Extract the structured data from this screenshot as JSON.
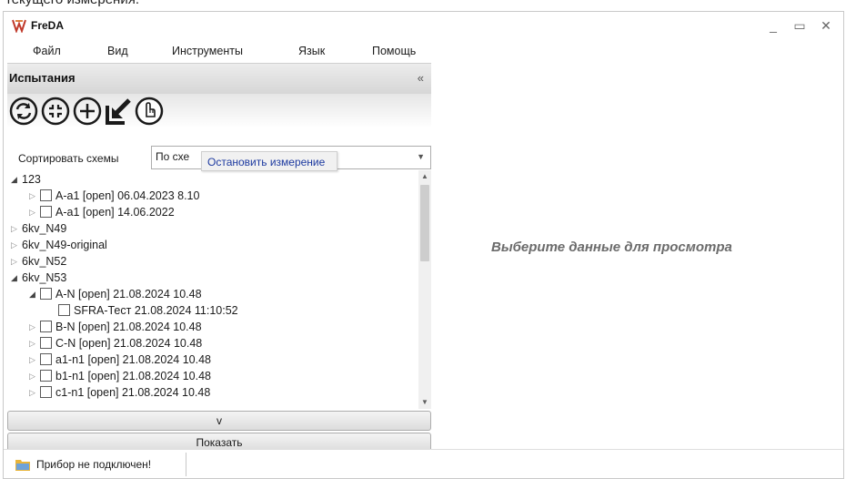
{
  "top_strip": {
    "text": "текущего измерения."
  },
  "window": {
    "title": "FreDA",
    "controls": {
      "minimize": "_",
      "maximize": "▭",
      "close": "✕"
    }
  },
  "menu": [
    "Файл",
    "Вид",
    "Инструменты",
    "Язык",
    "Помощь"
  ],
  "panel": {
    "title": "Испытания",
    "collapse_glyph": "«",
    "toolbar_icons": [
      "refresh-icon",
      "fit-icon",
      "add-icon",
      "import-icon",
      "stop-measurement-icon"
    ],
    "sort": {
      "label": "Сортировать схемы",
      "value": "По схе"
    },
    "tooltip": "Остановить измерение",
    "tree": [
      {
        "text": "123",
        "level": 0,
        "expand": "open",
        "checkbox": false
      },
      {
        "text": "A-a1 [open] 06.04.2023 8.10",
        "level": 1,
        "expand": "closed",
        "checkbox": true
      },
      {
        "text": "A-a1 [open] 14.06.2022",
        "level": 1,
        "expand": "closed",
        "checkbox": true
      },
      {
        "text": "6kv_N49",
        "level": 0,
        "expand": "closed",
        "checkbox": false
      },
      {
        "text": "6kv_N49-original",
        "level": 0,
        "expand": "closed",
        "checkbox": false
      },
      {
        "text": "6kv_N52",
        "level": 0,
        "expand": "closed",
        "checkbox": false
      },
      {
        "text": "6kv_N53",
        "level": 0,
        "expand": "open",
        "checkbox": false
      },
      {
        "text": "A-N [open] 21.08.2024 10.48",
        "level": 1,
        "expand": "open",
        "checkbox": true
      },
      {
        "text": "SFRA-Тест 21.08.2024 11:10:52",
        "level": 2,
        "expand": "none",
        "checkbox": true
      },
      {
        "text": "B-N [open] 21.08.2024 10.48",
        "level": 1,
        "expand": "closed",
        "checkbox": true
      },
      {
        "text": "C-N [open] 21.08.2024 10.48",
        "level": 1,
        "expand": "closed",
        "checkbox": true
      },
      {
        "text": "a1-n1 [open] 21.08.2024 10.48",
        "level": 1,
        "expand": "closed",
        "checkbox": true
      },
      {
        "text": "b1-n1 [open] 21.08.2024 10.48",
        "level": 1,
        "expand": "closed",
        "checkbox": true
      },
      {
        "text": "c1-n1 [open] 21.08.2024 10.48",
        "level": 1,
        "expand": "closed",
        "checkbox": true
      }
    ],
    "expand_button": "v",
    "show_button": "Показать"
  },
  "placeholder": "Выберите данные для просмотра",
  "status": {
    "text": "Прибор не подключен!"
  },
  "colors": {
    "accent": "#1d3aa0",
    "logo": "#c0392b",
    "folder": "#e8b43a"
  }
}
